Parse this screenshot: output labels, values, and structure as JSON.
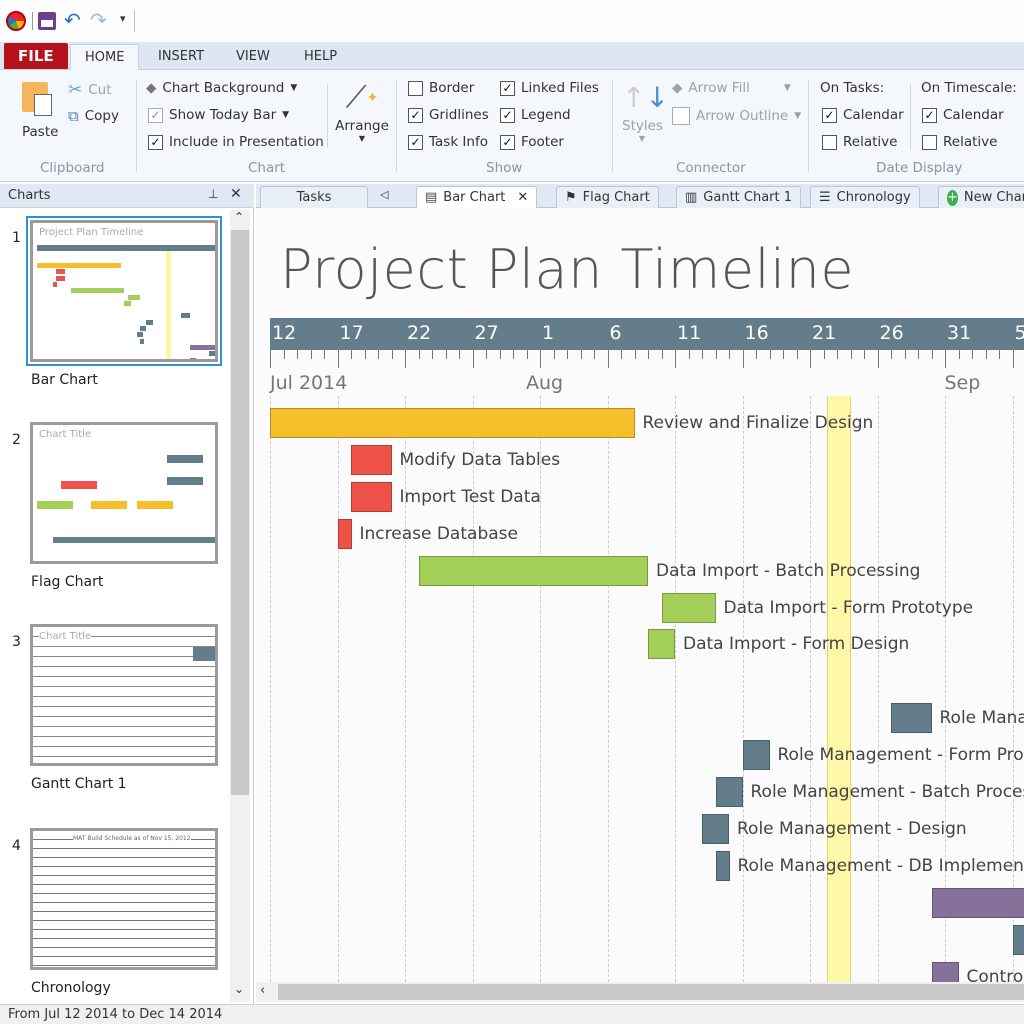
{
  "menu_tabs": [
    "FILE",
    "HOME",
    "INSERT",
    "VIEW",
    "HELP"
  ],
  "ribbon": {
    "clipboard": {
      "paste": "Paste",
      "cut": "Cut",
      "copy": "Copy",
      "group": "Clipboard"
    },
    "chart": {
      "background": "Chart Background",
      "today_bar": "Show Today Bar",
      "include": "Include in Presentation",
      "arrange": "Arrange",
      "group": "Chart",
      "today_bar_checked": true,
      "include_checked": true
    },
    "show": {
      "group": "Show",
      "items": [
        {
          "label": "Border",
          "checked": false
        },
        {
          "label": "Linked Files",
          "checked": true
        },
        {
          "label": "Gridlines",
          "checked": true
        },
        {
          "label": "Legend",
          "checked": true
        },
        {
          "label": "Task Info",
          "checked": true
        },
        {
          "label": "Footer",
          "checked": true
        }
      ]
    },
    "connector": {
      "group": "Connector",
      "styles": "Styles",
      "arrow_fill": "Arrow Fill",
      "arrow_outline": "Arrow Outline"
    },
    "date_display": {
      "group": "Date Display",
      "on_tasks": "On Tasks:",
      "on_timescale": "On Timescale:",
      "tasks_calendar": {
        "label": "Calendar",
        "checked": true
      },
      "tasks_relative": {
        "label": "Relative",
        "checked": false
      },
      "ts_calendar": {
        "label": "Calendar",
        "checked": true
      },
      "ts_relative": {
        "label": "Relative",
        "checked": false
      }
    }
  },
  "panel": {
    "title": "Charts",
    "thumbnails": [
      {
        "num": "1",
        "name": "Bar Chart",
        "title": "Project Plan Timeline"
      },
      {
        "num": "2",
        "name": "Flag Chart",
        "title": "Chart Title"
      },
      {
        "num": "3",
        "name": "Gantt Chart 1",
        "title": "Chart Title"
      },
      {
        "num": "4",
        "name": "Chronology",
        "title": "MAT Build Schedule as of Nov 15, 2012"
      }
    ]
  },
  "doc_tabs": [
    "Tasks",
    "Bar Chart",
    "Flag Chart",
    "Gantt Chart 1",
    "Chronology",
    "New Chart"
  ],
  "status": "From Jul 12 2014  to Dec 14 2014",
  "chart_data": {
    "type": "bar",
    "title": "Project Plan Timeline",
    "x_start": "2014-07-12",
    "timescale_labels": [
      "12",
      "17",
      "22",
      "27",
      "1",
      "6",
      "11",
      "16",
      "21",
      "26",
      "31",
      "5"
    ],
    "month_labels": [
      {
        "label": "Jul 2014",
        "date": "2014-07-12"
      },
      {
        "label": "Aug",
        "date": "2014-08-01"
      },
      {
        "label": "Sep",
        "date": "2014-09-01"
      }
    ],
    "today": "2014-08-23",
    "gridlines": true,
    "colors": {
      "timescale": "#637d8b",
      "today": "#fff78c"
    },
    "tasks": [
      {
        "label": "Review and Finalize Design",
        "start": "2014-07-12",
        "end": "2014-08-08",
        "color": "#f5bf2c",
        "row": 0
      },
      {
        "label": "Modify Data Tables",
        "start": "2014-07-18",
        "end": "2014-07-21",
        "color": "#ee5248",
        "row": 1
      },
      {
        "label": "Import Test Data",
        "start": "2014-07-18",
        "end": "2014-07-21",
        "color": "#ee5248",
        "row": 2
      },
      {
        "label": "Increase Database",
        "start": "2014-07-17",
        "end": "2014-07-18",
        "color": "#ee5248",
        "row": 3
      },
      {
        "label": "Data Import - Batch Processing",
        "start": "2014-07-23",
        "end": "2014-08-09",
        "color": "#a3cf58",
        "row": 4
      },
      {
        "label": "Data Import - Form Prototype",
        "start": "2014-08-10",
        "end": "2014-08-14",
        "color": "#a3cf58",
        "row": 5
      },
      {
        "label": "Data Import - Form Design",
        "start": "2014-08-09",
        "end": "2014-08-11",
        "color": "#a3cf58",
        "row": 6
      },
      {
        "label": "Role Management",
        "start": "2014-08-27",
        "end": "2014-08-30",
        "color": "#637d8b",
        "row": 8
      },
      {
        "label": "Role Management - Form Prototype",
        "start": "2014-08-16",
        "end": "2014-08-18",
        "color": "#637d8b",
        "row": 9
      },
      {
        "label": "Role Management - Batch Processing",
        "start": "2014-08-14",
        "end": "2014-08-16",
        "color": "#637d8b",
        "row": 10
      },
      {
        "label": "Role Management - Design",
        "start": "2014-08-13",
        "end": "2014-08-15",
        "color": "#637d8b",
        "row": 11
      },
      {
        "label": "Role Management - DB Implementation",
        "start": "2014-08-14",
        "end": "2014-08-15",
        "color": "#637d8b",
        "row": 12
      },
      {
        "label": "",
        "start": "2014-08-30",
        "end": "2014-09-15",
        "color": "#86719a",
        "row": 13
      },
      {
        "label": "",
        "start": "2014-09-05",
        "end": "2014-09-08",
        "color": "#637d8b",
        "row": 14
      },
      {
        "label": "Control",
        "start": "2014-08-30",
        "end": "2014-09-01",
        "color": "#86719a",
        "row": 15
      }
    ]
  }
}
